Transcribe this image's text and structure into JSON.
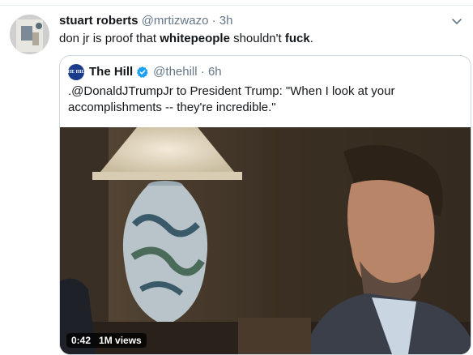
{
  "tweet": {
    "author_name": "stuart roberts",
    "author_handle": "@mrtizwazo",
    "time": "3h",
    "text_parts": [
      "don jr is proof that ",
      "whitepeople",
      " shouldn't ",
      "fuck",
      "."
    ]
  },
  "quoted": {
    "logo_text": "THE HILL",
    "author_name": "The Hill",
    "author_handle": "@thehill",
    "time": "6h",
    "text": ".@DonaldJTrumpJr to President Trump: \"When I look at your accomplishments -- they're incredible.\"",
    "video": {
      "duration": "0:42",
      "views": "1M views"
    }
  },
  "colors": {
    "verified": "#1da1f2",
    "border": "#ccd6dd",
    "meta": "#657786"
  },
  "icons": {
    "more": "chevron-down-icon",
    "verified": "verified-badge-icon"
  }
}
